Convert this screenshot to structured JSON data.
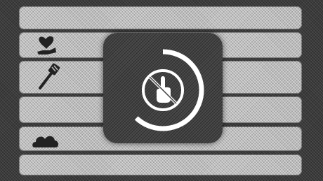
{
  "list": {
    "rows": [
      {
        "icon": ""
      },
      {
        "icon": "heart-hand-icon"
      },
      {
        "icon": "spatula-icon"
      },
      {
        "icon": ""
      },
      {
        "icon": "cloud-icon"
      },
      {
        "icon": ""
      }
    ]
  },
  "loading_overlay": {
    "icon": "no-touch-icon",
    "spinner_progress": 0.62
  },
  "colors": {
    "background": "#3b3b3b",
    "row": "#bdbdbd",
    "overlay": "#444444",
    "spinner": "#ffffff"
  }
}
